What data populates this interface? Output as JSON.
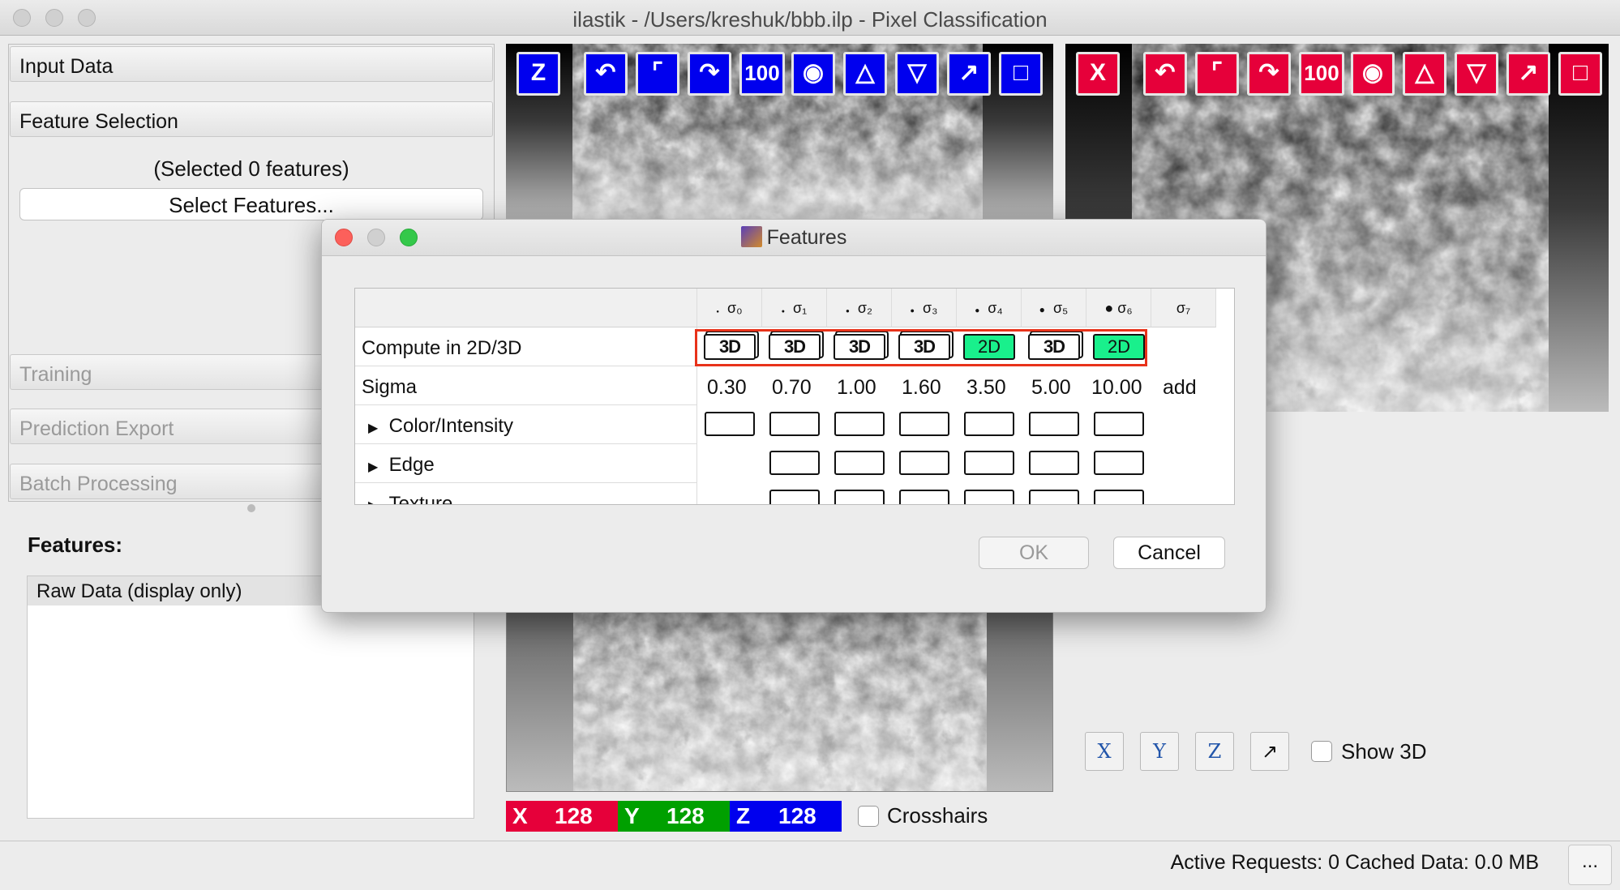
{
  "window": {
    "title": "ilastik - /Users/kreshuk/bbb.ilp - Pixel Classification"
  },
  "sidebar": {
    "applets": [
      "Input Data",
      "Feature Selection",
      "Training",
      "Prediction Export",
      "Batch Processing"
    ],
    "selected_count_text": "(Selected 0 features)",
    "select_button_label": "Select Features...",
    "features_label": "Features:",
    "layers": [
      "Raw Data (display only)"
    ]
  },
  "viewer_toolbar": {
    "zoom_label": "100"
  },
  "position": {
    "x_label": "X",
    "x_value": "128",
    "y_label": "Y",
    "y_value": "128",
    "z_label": "Z",
    "z_value": "128",
    "crosshairs_label": "Crosshairs",
    "colors": {
      "x": "#e6003a",
      "y": "#00a000",
      "z": "#0000ee"
    }
  },
  "view3d": {
    "buttons": [
      "X",
      "Y",
      "Z",
      "↗"
    ],
    "show_3d_label": "Show 3D"
  },
  "status": {
    "text": "Active Requests: 0  Cached Data: 0.0 MB",
    "more_label": "..."
  },
  "dialog": {
    "title": "Features",
    "sigma_headers": [
      "σ₀",
      "σ₁",
      "σ₂",
      "σ₃",
      "σ₄",
      "σ₅",
      "σ₆",
      "σ₇"
    ],
    "rows": {
      "compute": "Compute in 2D/3D",
      "sigma": "Sigma",
      "color": "Color/Intensity",
      "edge": "Edge",
      "texture": "Texture"
    },
    "compute_modes": [
      "3D",
      "3D",
      "3D",
      "3D",
      "2D",
      "3D",
      "2D"
    ],
    "sigma_values": [
      "0.30",
      "0.70",
      "1.00",
      "1.60",
      "3.50",
      "5.00",
      "10.00"
    ],
    "add_label": "add",
    "ok_label": "OK",
    "cancel_label": "Cancel",
    "highlight_color": "#e8321a"
  }
}
